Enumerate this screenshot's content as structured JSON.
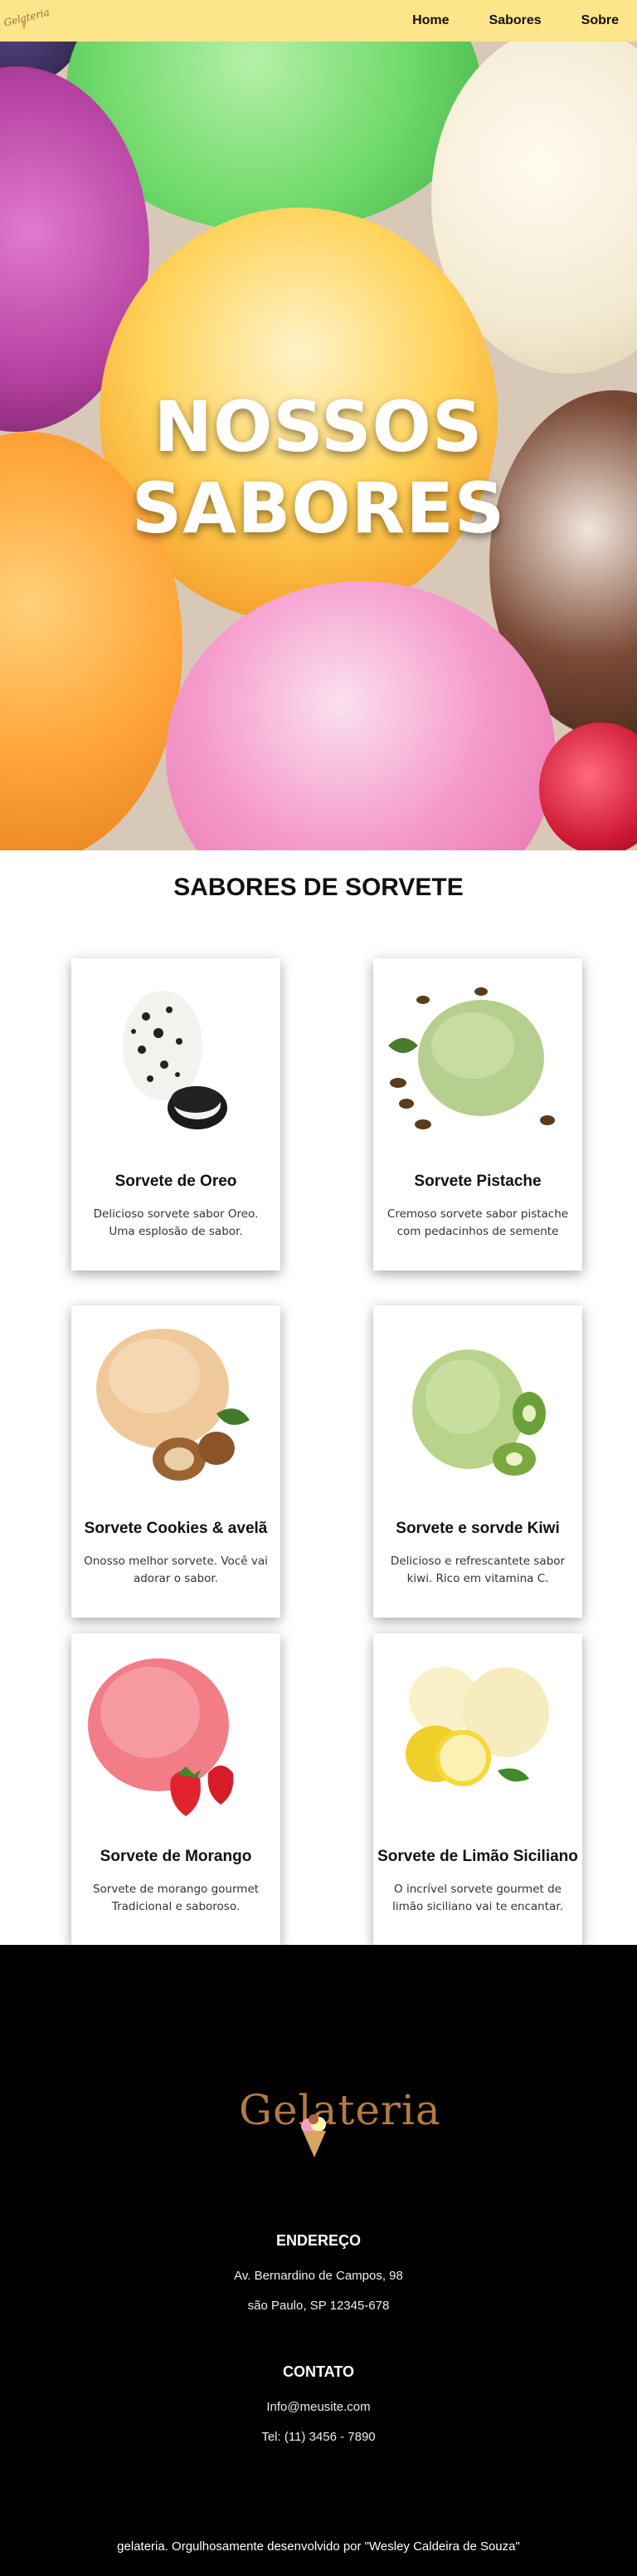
{
  "brand": {
    "logo_text": "Gelateria"
  },
  "nav": {
    "links": [
      "Home",
      "Sabores",
      "Sobre"
    ]
  },
  "hero": {
    "title": "NOSSOS SABORES"
  },
  "section": {
    "title": "SABORES DE SORVETE"
  },
  "cards": [
    {
      "title": "Sorvete de Oreo",
      "description": "Delicioso sorvete sabor Oreo. Uma esplosão de sabor."
    },
    {
      "title": "Sorvete Pistache",
      "description": "Cremoso sorvete sabor pistache com pedacinhos de semente"
    },
    {
      "title": "Sorvete Cookies & avelã",
      "description": "Onosso melhor sorvete. Você vai adorar o sabor."
    },
    {
      "title": "Sorvete e sorvde Kiwi",
      "description": "Delicioso e refrescantete sabor kiwi. Rico em vitamina C."
    },
    {
      "title": "Sorvete de Morango",
      "description": "Sorvete de morango gourmet Tradicional e saboroso."
    },
    {
      "title": "Sorvete de Limão Siciliano",
      "description": "O incrível sorvete gourmet de limão siciliano vai te encantar."
    }
  ],
  "footer": {
    "address_heading": "ENDEREÇO",
    "address_line1": "Av. Bernardino de Campos, 98",
    "address_line2": "são Paulo, SP 12345-678",
    "contact_heading": "CONTATO",
    "email": "Info@meusite.com",
    "phone": "Tel: (11) 3456 - 7890",
    "copyright": "gelateria. Orgulhosamente desenvolvido por \"Wesley Caldeira de Souza\""
  },
  "colors": {
    "nav_bg": "#fce58a",
    "footer_bg": "#000000",
    "logo_brown": "#b27a42"
  }
}
